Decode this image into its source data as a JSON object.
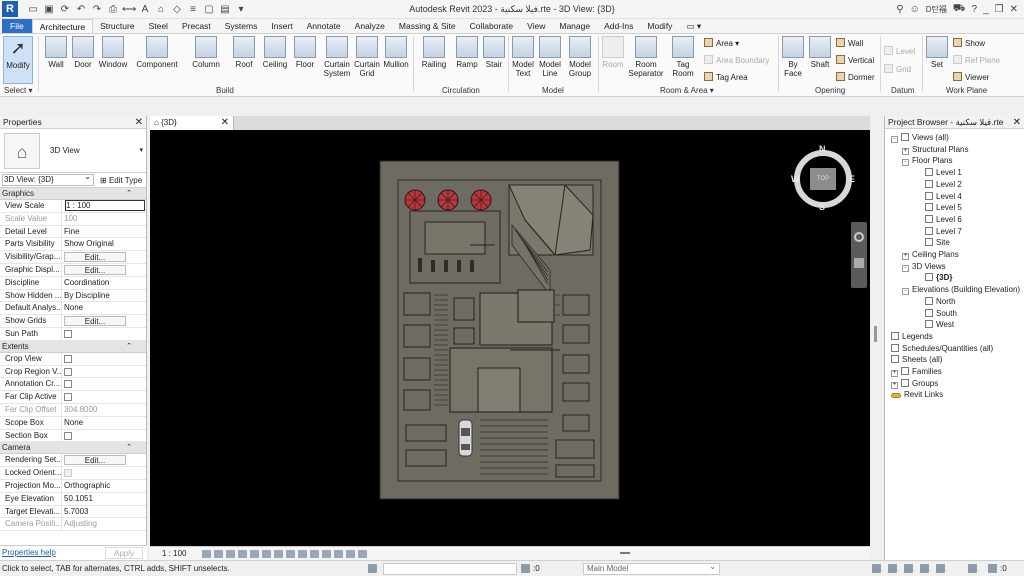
{
  "app": {
    "logo_letter": "R",
    "window_title": "Autodesk Revit 2023 - فيلا سكنية.rte - 3D View: {3D}",
    "user_name": "D탄福",
    "window_controls": [
      "_",
      "❐",
      "✕"
    ]
  },
  "tabs": [
    {
      "label": "File",
      "kind": "file"
    },
    {
      "label": "Architecture",
      "kind": "active"
    },
    {
      "label": "Structure"
    },
    {
      "label": "Steel"
    },
    {
      "label": "Precast"
    },
    {
      "label": "Systems"
    },
    {
      "label": "Insert"
    },
    {
      "label": "Annotate"
    },
    {
      "label": "Analyze"
    },
    {
      "label": "Massing & Site"
    },
    {
      "label": "Collaborate"
    },
    {
      "label": "View"
    },
    {
      "label": "Manage"
    },
    {
      "label": "Add-Ins"
    },
    {
      "label": "Modify"
    }
  ],
  "ribbon": {
    "buttons": {
      "modify": "Modify",
      "wall": "Wall",
      "door": "Door",
      "window": "Window",
      "component": "Component",
      "column": "Column",
      "roof": "Roof",
      "ceiling": "Ceiling",
      "floor": "Floor",
      "curtain_system": "Curtain System",
      "curtain_grid": "Curtain Grid",
      "mullion": "Mullion",
      "railing": "Railing",
      "ramp": "Ramp",
      "stair": "Stair",
      "model_text": "Model Text",
      "model_line": "Model Line",
      "model_group": "Model Group",
      "room": "Room",
      "room_separator": "Room Separator",
      "tag_room": "Tag Room",
      "area": "Area",
      "area_boundary": "Area Boundary",
      "tag_area": "Tag Area",
      "by_face": "By Face",
      "shaft": "Shaft",
      "wall_opening": "Wall",
      "vertical": "Vertical",
      "dormer": "Dormer",
      "level": "Level",
      "grid": "Grid",
      "set": "Set",
      "show": "Show",
      "ref_plane": "Ref Plane",
      "viewer": "Viewer"
    },
    "panels": {
      "select": "Select ▾",
      "build": "Build",
      "circulation": "Circulation",
      "model": "Model",
      "room_area": "Room & Area ▾",
      "opening": "Opening",
      "datum": "Datum",
      "work_plane": "Work Plane"
    }
  },
  "properties": {
    "title": "Properties",
    "type_name": "3D View",
    "instance": "3D View: {3D}",
    "edit_type": "Edit Type",
    "groups": {
      "graphics": "Graphics",
      "extents": "Extents",
      "camera": "Camera"
    },
    "graphics_rows": [
      {
        "k": "View Scale",
        "v": "1 : 100",
        "style": "boxed"
      },
      {
        "k": "Scale Value",
        "v": "100",
        "style": "dis",
        "k2": "1:"
      },
      {
        "k": "Detail Level",
        "v": "Fine"
      },
      {
        "k": "Parts Visibility",
        "v": "Show Original"
      },
      {
        "k": "Visibility/Grap...",
        "v": "Edit...",
        "style": "btn"
      },
      {
        "k": "Graphic Displ...",
        "v": "Edit...",
        "style": "btn"
      },
      {
        "k": "Discipline",
        "v": "Coordination"
      },
      {
        "k": "Show Hidden ...",
        "v": "By Discipline"
      },
      {
        "k": "Default Analys...",
        "v": "None"
      },
      {
        "k": "Show Grids",
        "v": "Edit...",
        "style": "btn"
      },
      {
        "k": "Sun Path",
        "v": "",
        "style": "chk"
      }
    ],
    "extents_rows": [
      {
        "k": "Crop View",
        "v": "",
        "style": "chk"
      },
      {
        "k": "Crop Region V...",
        "v": "",
        "style": "chk"
      },
      {
        "k": "Annotation Cr...",
        "v": "",
        "style": "chk"
      },
      {
        "k": "Far Clip Active",
        "v": "",
        "style": "chk"
      },
      {
        "k": "Far Clip Offset",
        "v": "304.8000",
        "style": "dis"
      },
      {
        "k": "Scope Box",
        "v": "None"
      },
      {
        "k": "Section Box",
        "v": "",
        "style": "chk"
      }
    ],
    "camera_rows": [
      {
        "k": "Rendering Set...",
        "v": "Edit...",
        "style": "btn"
      },
      {
        "k": "Locked Orient...",
        "v": "",
        "style": "chkdis"
      },
      {
        "k": "Projection Mo...",
        "v": "Orthographic"
      },
      {
        "k": "Eye Elevation",
        "v": "50.1051"
      },
      {
        "k": "Target Elevati...",
        "v": "5.7003"
      },
      {
        "k": "Camera Positi...",
        "v": "Adjusting",
        "style": "dis"
      }
    ],
    "help": "Properties help",
    "apply": "Apply"
  },
  "view": {
    "tab_label": "{3D}",
    "scale": "1 : 100",
    "viewcube": {
      "top": "TOP",
      "n": "N",
      "s": "S",
      "e": "E",
      "w": "W"
    }
  },
  "browser": {
    "title": "Project Browser - فيلا سكنية.rte",
    "nodes": [
      {
        "label": "Views (all)",
        "level": 0,
        "pm": "-",
        "icon": true
      },
      {
        "label": "Structural Plans",
        "level": 1,
        "pm": "+"
      },
      {
        "label": "Floor Plans",
        "level": 1,
        "pm": "-"
      },
      {
        "label": "Level 1",
        "level": 2
      },
      {
        "label": "Level 2",
        "level": 2
      },
      {
        "label": "Level 4",
        "level": 2
      },
      {
        "label": "Level 5",
        "level": 2
      },
      {
        "label": "Level 6",
        "level": 2
      },
      {
        "label": "Level 7",
        "level": 2
      },
      {
        "label": "Site",
        "level": 2
      },
      {
        "label": "Ceiling Plans",
        "level": 1,
        "pm": "+"
      },
      {
        "label": "3D Views",
        "level": 1,
        "pm": "-"
      },
      {
        "label": "{3D}",
        "level": 2,
        "bold": true
      },
      {
        "label": "Elevations (Building Elevation)",
        "level": 1,
        "pm": "-"
      },
      {
        "label": "North",
        "level": 2
      },
      {
        "label": "South",
        "level": 2
      },
      {
        "label": "West",
        "level": 2
      },
      {
        "label": "Legends",
        "level": 0,
        "icon": true
      },
      {
        "label": "Schedules/Quantities (all)",
        "level": 0,
        "icon": true
      },
      {
        "label": "Sheets (all)",
        "level": 0,
        "icon": true
      },
      {
        "label": "Families",
        "level": 0,
        "pm": "+",
        "icon": true
      },
      {
        "label": "Groups",
        "level": 0,
        "pm": "+",
        "icon": true
      },
      {
        "label": "Revit Links",
        "level": 0,
        "link": true
      }
    ]
  },
  "status": {
    "text": "Click to select, TAB for alternates, CTRL adds, SHIFT unselects.",
    "zero": ":0",
    "model": "Main Model",
    "filter": ":0"
  }
}
